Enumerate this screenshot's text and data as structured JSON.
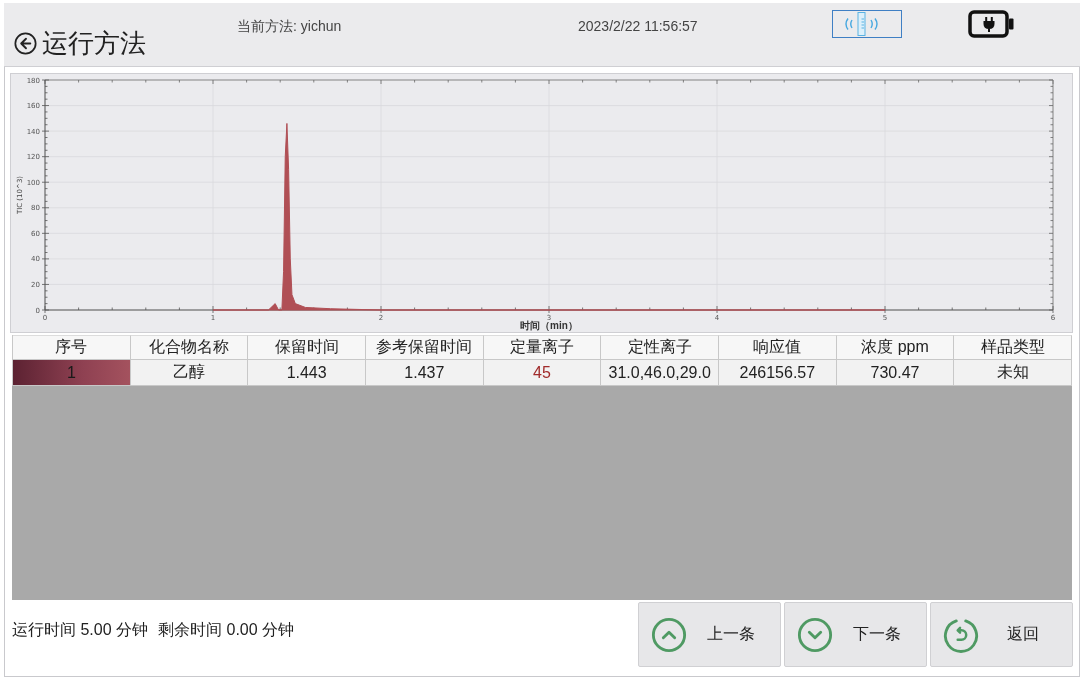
{
  "header": {
    "title": "运行方法",
    "method": "当前方法: yichun",
    "datetime": "2023/2/22 11:56:57"
  },
  "chart": {
    "chart_data": {
      "type": "area",
      "grid": true,
      "xlabel": "时间（min）",
      "ylabel": "TIC (10^3)",
      "x": [
        1.0,
        1.33,
        1.37,
        1.39,
        1.41,
        1.42,
        1.43,
        1.44,
        1.45,
        1.46,
        1.47,
        1.49,
        1.55,
        1.7,
        2.0,
        5.0
      ],
      "series": [
        {
          "color": "#b04f55",
          "values": [
            0,
            0,
            5,
            0,
            0,
            30,
            120,
            146,
            110,
            40,
            12,
            5,
            2,
            1,
            0,
            0
          ]
        }
      ],
      "xlim": [
        0,
        6
      ],
      "ylim": [
        0,
        180
      ],
      "xticks": [
        0,
        1,
        2,
        3,
        4,
        5,
        6
      ],
      "yticks": [
        0,
        20,
        40,
        60,
        80,
        100,
        120,
        140,
        160,
        180
      ]
    }
  },
  "table": {
    "columns": [
      "序号",
      "化合物名称",
      "保留时间",
      "参考保留时间",
      "定量离子",
      "定性离子",
      "响应值",
      "浓度 ppm",
      "样品类型"
    ],
    "rows": [
      {
        "selected": true,
        "cells": [
          "1",
          "乙醇",
          "1.443",
          "1.437",
          "45",
          "31.0,46.0,29.0",
          "246156.57",
          "730.47",
          "未知"
        ]
      }
    ]
  },
  "status": [
    "运行时间 5.00 分钟",
    "剩余时间 0.00 分钟"
  ],
  "buttons": [
    {
      "kind": "up",
      "label": "上一条"
    },
    {
      "kind": "down",
      "label": "下一条"
    },
    {
      "kind": "back",
      "label": "返回"
    }
  ]
}
